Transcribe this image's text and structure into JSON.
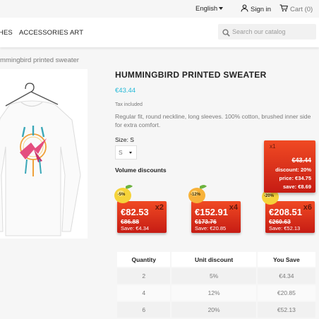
{
  "topbar": {
    "language": "English",
    "sign_in": "Sign in",
    "cart": "Cart (0)"
  },
  "nav": {
    "items": [
      "HES",
      "ACCESSORIES",
      "ART"
    ],
    "search_placeholder": "Search our catalog"
  },
  "breadcrumb": "mmingbird printed sweater",
  "product": {
    "title": "HUMMINGBIRD PRINTED SWEATER",
    "price": "€43.44",
    "tax_note": "Tax included",
    "description": "Regular fit, round neckline, long sleeves. 100% cotton, brushed inner side for extra comfort.",
    "size_label": "Size: S",
    "size_value": "S"
  },
  "volume_discounts": {
    "title": "Volume discounts",
    "cards": [
      {
        "qty": "x2",
        "badge": "-5%",
        "price": "€82.53",
        "old_price": "€86.88",
        "save": "Save: €4.34"
      },
      {
        "qty": "x4",
        "badge": "-12%",
        "price": "€152.91",
        "old_price": "€173.76",
        "save": "Save: €20.85"
      },
      {
        "qty": "x6",
        "badge": "-20%",
        "price": "€208.51",
        "old_price": "€260.63",
        "save": "Save: €52.13"
      }
    ],
    "tooltip": {
      "qty": "x1",
      "old_price": "€43.44",
      "discount": "discount: 20%",
      "price": "price: €34.75",
      "save": "save: €8.69"
    },
    "table": {
      "headers": [
        "Quantity",
        "Unit discount",
        "You Save"
      ],
      "rows": [
        [
          "2",
          "5%",
          "€4.34"
        ],
        [
          "4",
          "12%",
          "€20.85"
        ],
        [
          "6",
          "20%",
          "€52.13"
        ]
      ]
    }
  },
  "colors": {
    "accent": "#24b9d7",
    "discount_red": "#e0321c"
  }
}
